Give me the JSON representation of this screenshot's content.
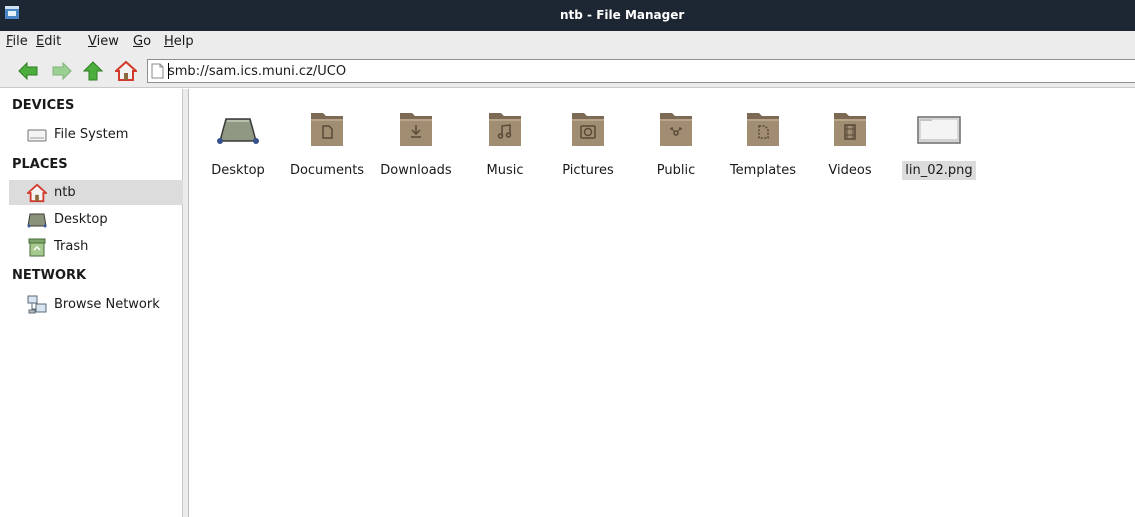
{
  "window": {
    "title": "ntb - File Manager",
    "app_icon": "file-manager-icon"
  },
  "menubar": {
    "items": [
      {
        "label": "File",
        "mnemonic": "F",
        "rest": "ile"
      },
      {
        "label": "Edit",
        "mnemonic": "E",
        "rest": "dit"
      },
      {
        "label": "View",
        "mnemonic": "V",
        "rest": "iew"
      },
      {
        "label": "Go",
        "mnemonic": "G",
        "rest": "o"
      },
      {
        "label": "Help",
        "mnemonic": "H",
        "rest": "elp"
      }
    ]
  },
  "toolbar": {
    "back_icon": "back-arrow-icon",
    "forward_icon": "forward-arrow-icon",
    "up_icon": "up-arrow-icon",
    "home_icon": "home-icon",
    "location": "smb://sam.ics.muni.cz/UČO"
  },
  "sidebar": {
    "sections": {
      "devices": "DEVICES",
      "places": "PLACES",
      "network": "NETWORK"
    },
    "items": {
      "file_system": "File System",
      "home": "ntb",
      "desktop": "Desktop",
      "trash": "Trash",
      "browse_network": "Browse Network"
    }
  },
  "files": [
    {
      "name": "Desktop",
      "icon": "desktop-icon"
    },
    {
      "name": "Documents",
      "icon": "documents-folder-icon"
    },
    {
      "name": "Downloads",
      "icon": "downloads-folder-icon"
    },
    {
      "name": "Music",
      "icon": "music-folder-icon"
    },
    {
      "name": "Pictures",
      "icon": "pictures-folder-icon"
    },
    {
      "name": "Public",
      "icon": "public-folder-icon"
    },
    {
      "name": "Templates",
      "icon": "templates-folder-icon"
    },
    {
      "name": "Videos",
      "icon": "videos-folder-icon"
    },
    {
      "name": "lin_02.png",
      "icon": "image-file-icon",
      "selected": true
    }
  ],
  "colors": {
    "titlebar": "#1d2633",
    "folder": "#a08d72",
    "folder_dark": "#7c6a54",
    "selection": "#dcdcdc",
    "arrow_green": "#4caf3d",
    "home_red": "#d23a2b"
  }
}
